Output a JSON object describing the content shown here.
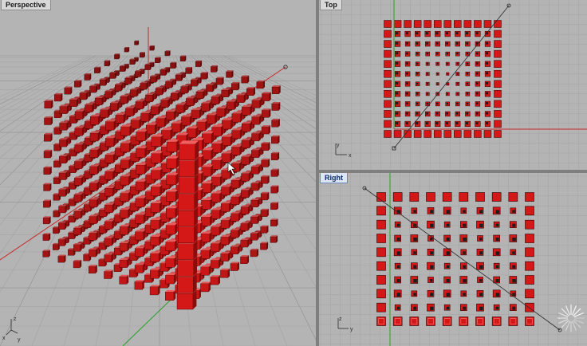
{
  "viewports": {
    "perspective": {
      "title": "Perspective",
      "active": false
    },
    "top": {
      "title": "Top",
      "active": false
    },
    "right": {
      "title": "Right",
      "active": true
    }
  },
  "axis_labels": {
    "x": "x",
    "y": "y",
    "z": "z"
  },
  "colors": {
    "viewport_bg": "#b4b4b4",
    "grid_minor": "#a3a3a3",
    "grid_major": "#8f8f8f",
    "axis_x": "#c82828",
    "axis_y": "#28a028",
    "axis_z": "#b43030",
    "cube_face": "#d41818",
    "cube_side": "#8c0c0c",
    "cube_top": "#ff6464",
    "frame": "#7f7f7f"
  }
}
